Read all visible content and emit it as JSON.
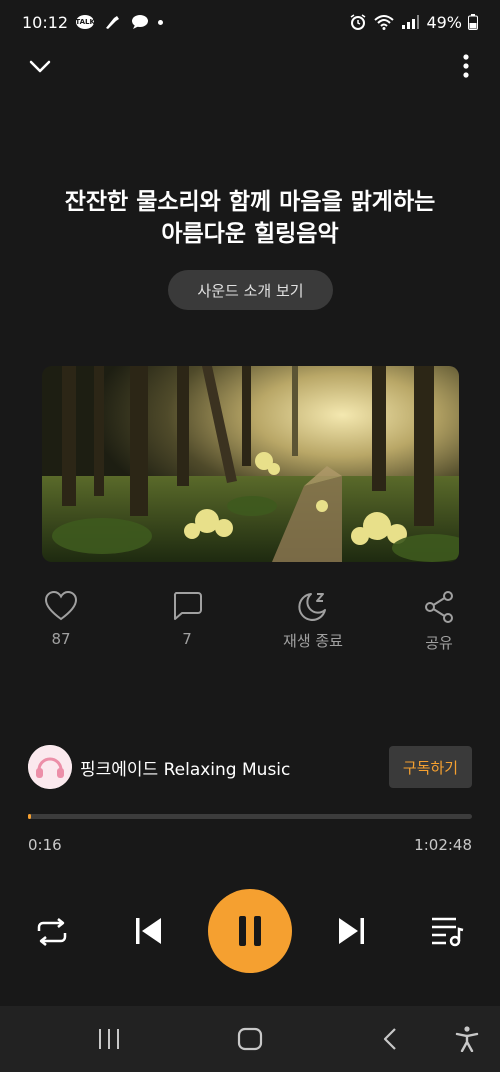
{
  "status_bar": {
    "time": "10:12",
    "talk_badge": "TALK",
    "battery": "49%"
  },
  "track": {
    "title_line1": "잔잔한 물소리와 함께 마음을 맑게하는",
    "title_line2": "아름다운 힐링음악",
    "intro_button": "사운드 소개 보기"
  },
  "actions": {
    "like_count": "87",
    "comment_count": "7",
    "sleep_label": "재생 종료",
    "share_label": "공유"
  },
  "channel": {
    "name": "핑크에이드 Relaxing Music",
    "subscribe_label": "구독하기"
  },
  "playback": {
    "current_time": "0:16",
    "total_time": "1:02:48",
    "progress_fraction": 0.004,
    "is_playing": true
  },
  "colors": {
    "accent": "#f5a030",
    "background": "#181818"
  },
  "icons": [
    "chevron-down-icon",
    "more-vert-icon",
    "heart-icon",
    "comment-icon",
    "moon-sleep-icon",
    "share-icon",
    "repeat-icon",
    "skip-previous-icon",
    "pause-icon",
    "skip-next-icon",
    "playlist-icon",
    "recent-apps-icon",
    "home-icon",
    "back-icon",
    "accessibility-icon"
  ]
}
